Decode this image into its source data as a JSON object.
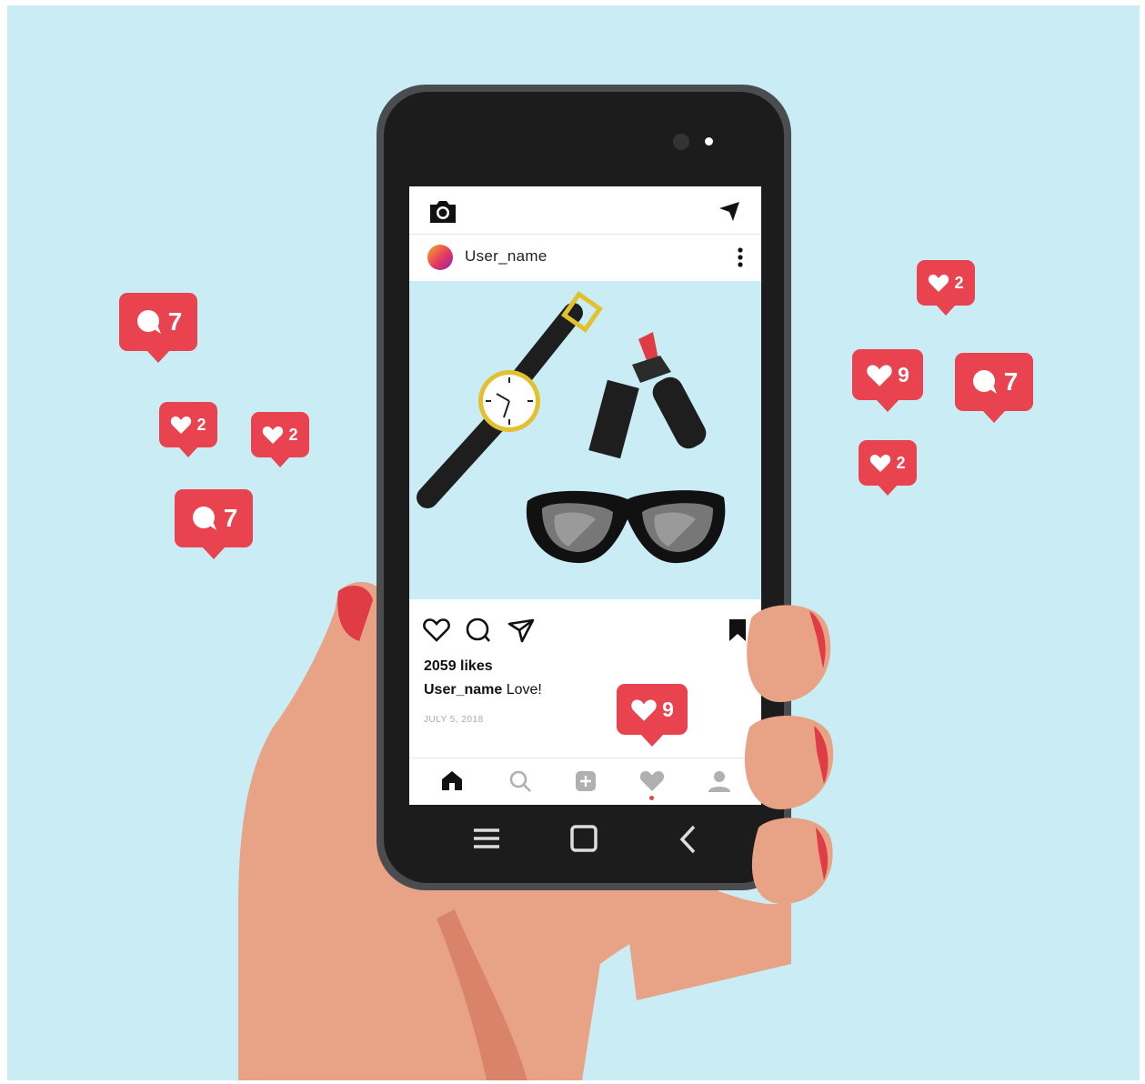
{
  "app": {
    "username": "User_name",
    "likes": "2059 likes",
    "caption_user": "User_name",
    "caption_text": " Love!",
    "date": "JULY 5, 2018"
  },
  "bubbles": {
    "left_comment_top": "7",
    "left_like_1": "2",
    "left_like_2": "2",
    "left_comment_bottom": "7",
    "right_like_top": "2",
    "right_like_mid": "9",
    "right_comment": "7",
    "right_like_bottom": "2",
    "screen_like": "9"
  },
  "icons": {
    "camera": "camera-icon",
    "send": "send-icon",
    "more": "more-vertical-icon",
    "like": "heart-outline-icon",
    "comment": "comment-icon",
    "share": "send-icon",
    "save": "bookmark-icon",
    "home": "home-icon",
    "search": "search-icon",
    "add": "add-post-icon",
    "activity": "heart-icon",
    "profile": "profile-icon",
    "menu": "menu-icon",
    "square": "home-square-icon",
    "back": "back-icon"
  },
  "colors": {
    "background": "#c9ecf5",
    "notification_red": "#e8434f",
    "phone_body": "#1c1c1c",
    "skin": "#e8a285",
    "nail": "#e03c46"
  }
}
